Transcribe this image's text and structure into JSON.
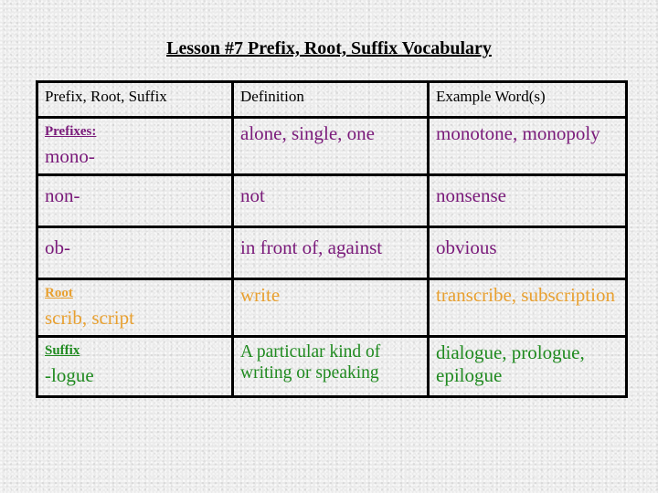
{
  "title": "Lesson #7 Prefix, Root, Suffix Vocabulary",
  "colors": {
    "prefix": "#7a1a7a",
    "root": "#e8a030",
    "suffix": "#1f8a1f",
    "header": "#000000"
  },
  "table": {
    "headers": [
      "Prefix, Root, Suffix",
      "Definition",
      "Example Word(s)"
    ],
    "rows": [
      {
        "section_label": "Prefixes:",
        "term": "mono-",
        "definition": "alone, single, one",
        "examples": "monotone, monopoly",
        "group": "prefix"
      },
      {
        "section_label": "",
        "term": "non-",
        "definition": "not",
        "examples": "nonsense",
        "group": "prefix"
      },
      {
        "section_label": "",
        "term": "ob-",
        "definition": "in front of, against",
        "examples": "obvious",
        "group": "prefix"
      },
      {
        "section_label": "Root",
        "term": "scrib, script",
        "definition": "write",
        "examples": "transcribe, subscription",
        "group": "root"
      },
      {
        "section_label": "Suffix",
        "term": "-logue",
        "definition": "A particular kind of writing or speaking",
        "examples": "dialogue, prologue, epilogue",
        "group": "suffix"
      }
    ]
  }
}
